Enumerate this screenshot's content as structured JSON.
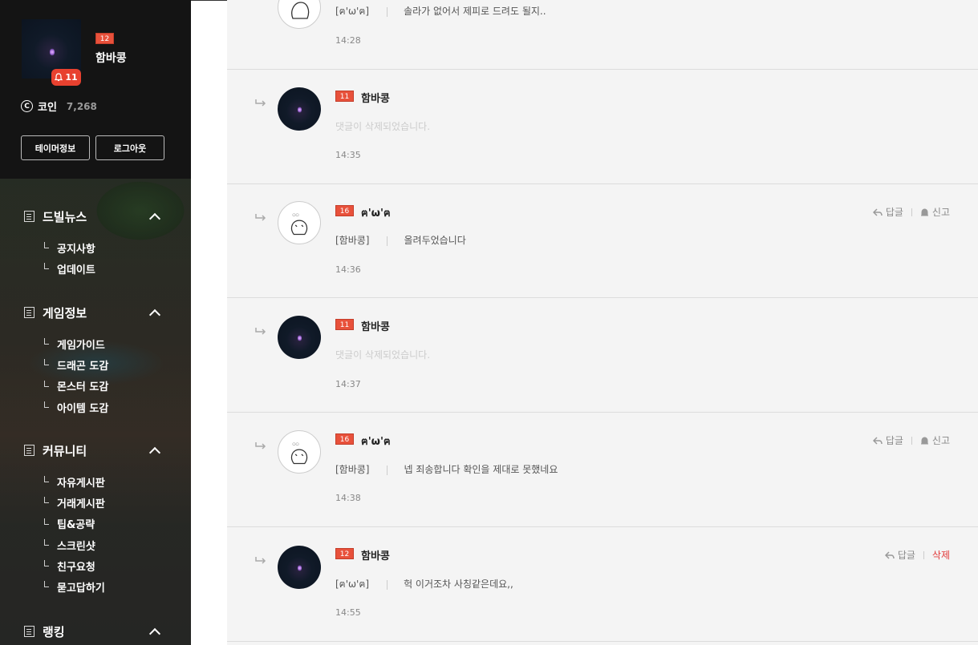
{
  "sidebar": {
    "profile": {
      "level": "12",
      "username": "함바콩",
      "notification_count": "11"
    },
    "coin": {
      "label": "코인",
      "value": "7,268",
      "icon": "coin-icon"
    },
    "buttons": {
      "profile_info": "테이머정보",
      "logout": "로그아웃"
    },
    "menus": [
      {
        "title": "드빌뉴스",
        "items": [
          "공지사항",
          "업데이트"
        ]
      },
      {
        "title": "게임정보",
        "items": [
          "게임가이드",
          "드래곤 도감",
          "몬스터 도감",
          "아이템 도감"
        ]
      },
      {
        "title": "커뮤니티",
        "items": [
          "자유게시판",
          "거래게시판",
          "팁&공략",
          "스크린샷",
          "친구요청",
          "묻고답하기"
        ]
      },
      {
        "title": "랭킹",
        "items": []
      }
    ]
  },
  "comments": [
    {
      "level": "",
      "name": "",
      "mention": "[ฅ'ω'ฅ]",
      "text": "솔라가 없어서 제피로 드려도 될지..",
      "time": "14:28",
      "deleted": false,
      "actions": []
    },
    {
      "level": "11",
      "name": "함바콩",
      "mention": "",
      "text": "댓글이 삭제되었습니다.",
      "time": "14:35",
      "deleted": true,
      "actions": []
    },
    {
      "level": "16",
      "name": "ฅ'ω'ฅ",
      "mention": "[함바콩]",
      "text": "올려두었습니다",
      "time": "14:36",
      "deleted": false,
      "actions": [
        "답글",
        "신고"
      ]
    },
    {
      "level": "11",
      "name": "함바콩",
      "mention": "",
      "text": "댓글이 삭제되었습니다.",
      "time": "14:37",
      "deleted": true,
      "actions": []
    },
    {
      "level": "16",
      "name": "ฅ'ω'ฅ",
      "mention": "[함바콩]",
      "text": "넵 죄송합니다 확인을 제대로 못했네요",
      "time": "14:38",
      "deleted": false,
      "actions": [
        "답글",
        "신고"
      ]
    },
    {
      "level": "12",
      "name": "함바콩",
      "mention": "[ฅ'ω'ฅ]",
      "text": "헉 이거조차 사칭같은데요,,",
      "time": "14:55",
      "deleted": false,
      "actions": [
        "답글",
        "삭제"
      ]
    }
  ],
  "colors": {
    "level_badge": "#e8513b",
    "notification_badge": "#e8412f",
    "delete_action": "#e23b3b",
    "sidebar_dark": "#141414",
    "main_bg": "#f4f4f4"
  }
}
